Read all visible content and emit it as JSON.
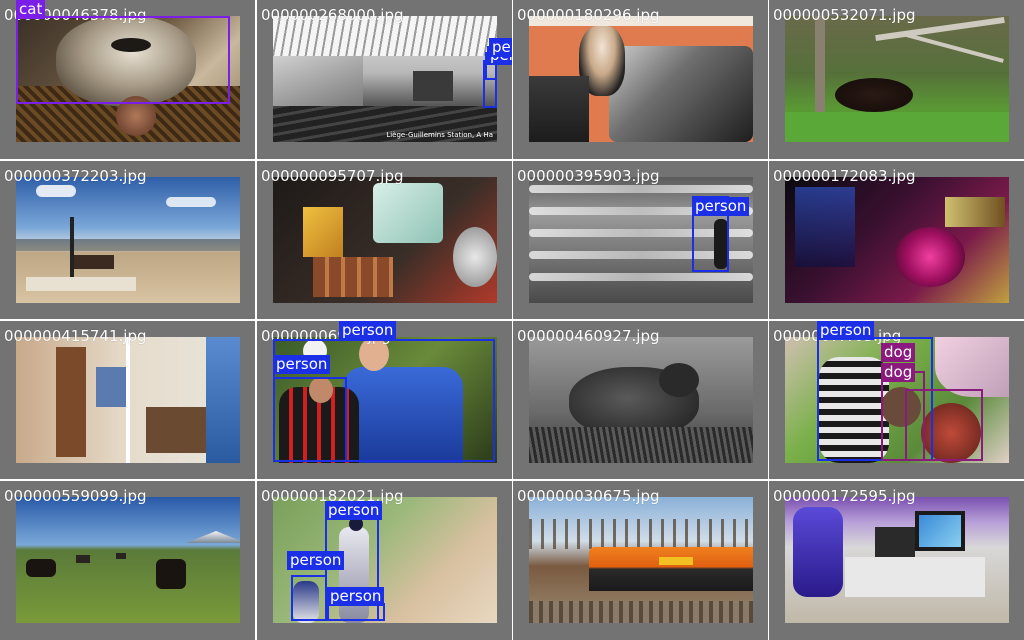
{
  "colors": {
    "background": "#ffffff",
    "tile": "#737373",
    "person": "#1a2fe6",
    "cat": "#7b1fe8",
    "dog": "#8a1a7e",
    "label_text": "#ffffff"
  },
  "tiles": [
    {
      "filename": "000000046378.jpg",
      "scene": "cat-closeup",
      "detections": [
        {
          "label": "cat",
          "color": "cat"
        }
      ]
    },
    {
      "filename": "000000268000.jpg",
      "scene": "train-station",
      "caption": "Liège-Guillemins Station, A Ha",
      "detections": [
        {
          "label": "person",
          "color": "person"
        },
        {
          "label": "person",
          "color": "person"
        }
      ]
    },
    {
      "filename": "000000180296.jpg",
      "scene": "doll-suitcase",
      "detections": []
    },
    {
      "filename": "000000532071.jpg",
      "scene": "bear-forest",
      "detections": []
    },
    {
      "filename": "000000372203.jpg",
      "scene": "bench-desert",
      "detections": []
    },
    {
      "filename": "000000095707.jpg",
      "scene": "food-table",
      "detections": []
    },
    {
      "filename": "000000395903.jpg",
      "scene": "surfer-waves",
      "detections": [
        {
          "label": "person",
          "color": "person"
        }
      ]
    },
    {
      "filename": "000000172083.jpg",
      "scene": "neon-machine",
      "detections": []
    },
    {
      "filename": "000000415741.jpg",
      "scene": "apartment-rooms",
      "detections": []
    },
    {
      "filename": "000000069??.jpg",
      "scene": "soccer-players",
      "detections": [
        {
          "label": "person",
          "color": "person"
        },
        {
          "label": "person",
          "color": "person"
        }
      ]
    },
    {
      "filename": "000000460927.jpg",
      "scene": "bear-grayscale",
      "detections": []
    },
    {
      "filename": "000000???05.jpg",
      "scene": "woman-dog",
      "detections": [
        {
          "label": "person",
          "color": "person"
        },
        {
          "label": "dog",
          "color": "dog"
        },
        {
          "label": "dog",
          "color": "dog"
        }
      ]
    },
    {
      "filename": "000000559099.jpg",
      "scene": "cows-field",
      "detections": []
    },
    {
      "filename": "000000182021.jpg",
      "scene": "baseball",
      "detections": [
        {
          "label": "person",
          "color": "person"
        },
        {
          "label": "person",
          "color": "person"
        },
        {
          "label": "person",
          "color": "person"
        }
      ]
    },
    {
      "filename": "000000030675.jpg",
      "scene": "bnsf-train",
      "detections": []
    },
    {
      "filename": "000000172595.jpg",
      "scene": "office-desk",
      "detections": []
    }
  ]
}
